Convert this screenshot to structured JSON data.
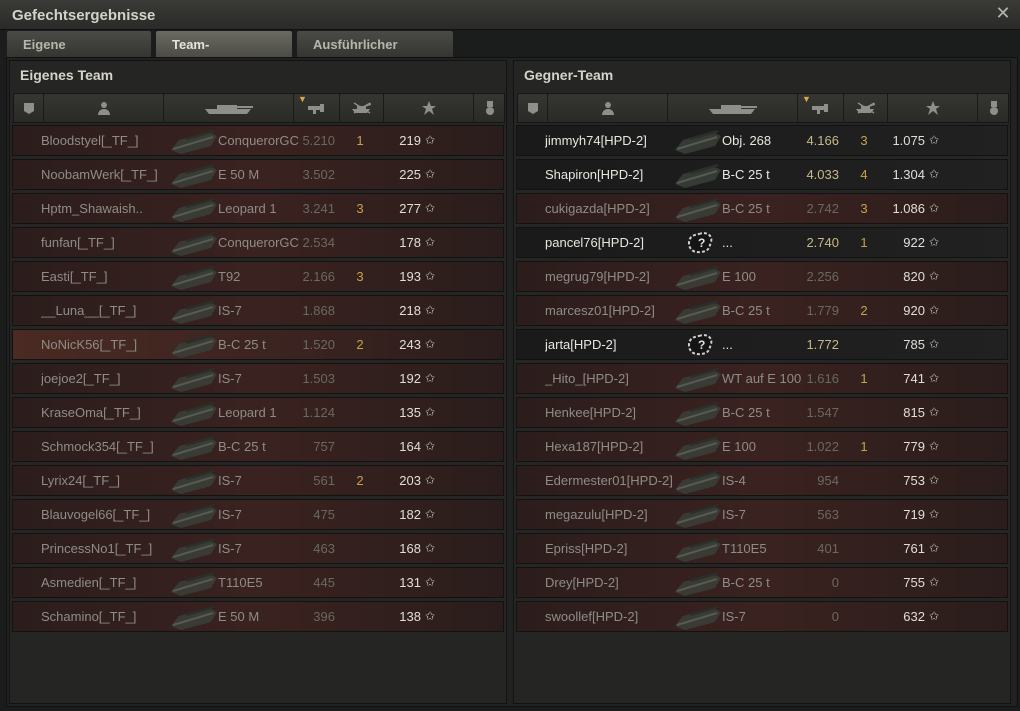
{
  "window": {
    "title": "Gefechtsergebnisse",
    "close_icon": "close-icon"
  },
  "tabs": [
    {
      "label": "Eigene Auswertung"
    },
    {
      "label": "Team-Auswertung"
    },
    {
      "label": "Ausführlicher Bericht"
    }
  ],
  "left_team": {
    "title": "Eigenes Team",
    "header_icons": [
      "squad-icon",
      "player-icon",
      "tank-icon",
      "damage-icon",
      "kills-icon",
      "experience-star-icon",
      "medal-icon"
    ],
    "rows": [
      {
        "player": "Bloodstyel[_TF_]",
        "tank": "ConquerorGC",
        "damage": "5.210",
        "kills": "1",
        "xp": "219"
      },
      {
        "player": "NoobamWerk[_TF_]",
        "tank": "E 50 M",
        "damage": "3.502",
        "kills": "",
        "xp": "225"
      },
      {
        "player": "Hptm_Shawaish..",
        "tank": "Leopard 1",
        "damage": "3.241",
        "kills": "3",
        "xp": "277"
      },
      {
        "player": "funfan[_TF_]",
        "tank": "ConquerorGC",
        "damage": "2.534",
        "kills": "",
        "xp": "178"
      },
      {
        "player": "Easti[_TF_]",
        "tank": "T92",
        "damage": "2.166",
        "kills": "3",
        "xp": "193"
      },
      {
        "player": "__Luna__[_TF_]",
        "tank": "IS-7",
        "damage": "1.868",
        "kills": "",
        "xp": "218"
      },
      {
        "player": "NoNicK56[_TF_]",
        "tank": "B-C 25 t",
        "damage": "1.520",
        "kills": "2",
        "xp": "243"
      },
      {
        "player": "joejoe2[_TF_]",
        "tank": "IS-7",
        "damage": "1.503",
        "kills": "",
        "xp": "192"
      },
      {
        "player": "KraseOma[_TF_]",
        "tank": "Leopard 1",
        "damage": "1.124",
        "kills": "",
        "xp": "135"
      },
      {
        "player": "Schmock354[_TF_]",
        "tank": "B-C 25 t",
        "damage": "757",
        "kills": "",
        "xp": "164"
      },
      {
        "player": "Lyrix24[_TF_]",
        "tank": "IS-7",
        "damage": "561",
        "kills": "2",
        "xp": "203"
      },
      {
        "player": "Blauvogel66[_TF_]",
        "tank": "IS-7",
        "damage": "475",
        "kills": "",
        "xp": "182"
      },
      {
        "player": "PrincessNo1[_TF_]",
        "tank": "IS-7",
        "damage": "463",
        "kills": "",
        "xp": "168"
      },
      {
        "player": "Asmedien[_TF_]",
        "tank": "T110E5",
        "damage": "445",
        "kills": "",
        "xp": "131"
      },
      {
        "player": "Schamino[_TF_]",
        "tank": "E 50 M",
        "damage": "396",
        "kills": "",
        "xp": "138"
      }
    ]
  },
  "right_team": {
    "title": "Gegner-Team",
    "rows": [
      {
        "player": "jimmyh74[HPD-2]",
        "tank": "Obj. 268",
        "damage": "4.166",
        "kills": "3",
        "xp": "1.075"
      },
      {
        "player": "Shapiron[HPD-2]",
        "tank": "B-C 25 t",
        "damage": "4.033",
        "kills": "4",
        "xp": "1.304"
      },
      {
        "player": "cukigazda[HPD-2]",
        "tank": "B-C 25 t",
        "damage": "2.742",
        "kills": "3",
        "xp": "1.086"
      },
      {
        "player": "pancel76[HPD-2]",
        "tank": "...",
        "damage": "2.740",
        "kills": "1",
        "xp": "922"
      },
      {
        "player": "megrug79[HPD-2]",
        "tank": "E 100",
        "damage": "2.256",
        "kills": "",
        "xp": "820"
      },
      {
        "player": "marcesz01[HPD-2]",
        "tank": "B-C 25 t",
        "damage": "1.779",
        "kills": "2",
        "xp": "920"
      },
      {
        "player": "jarta[HPD-2]",
        "tank": "...",
        "damage": "1.772",
        "kills": "",
        "xp": "785"
      },
      {
        "player": "_Hito_[HPD-2]",
        "tank": "WT auf E 100",
        "damage": "1.616",
        "kills": "1",
        "xp": "741"
      },
      {
        "player": "Henkee[HPD-2]",
        "tank": "B-C 25 t",
        "damage": "1.547",
        "kills": "",
        "xp": "815"
      },
      {
        "player": "Hexa187[HPD-2]",
        "tank": "E 100",
        "damage": "1.022",
        "kills": "1",
        "xp": "779"
      },
      {
        "player": "Edermester01[HPD-2]",
        "tank": "IS-4",
        "damage": "954",
        "kills": "",
        "xp": "753"
      },
      {
        "player": "megazulu[HPD-2]",
        "tank": "IS-7",
        "damage": "563",
        "kills": "",
        "xp": "719"
      },
      {
        "player": "Epriss[HPD-2]",
        "tank": "T110E5",
        "damage": "401",
        "kills": "",
        "xp": "761"
      },
      {
        "player": "Drey[HPD-2]",
        "tank": "B-C 25 t",
        "damage": "0",
        "kills": "",
        "xp": "755"
      },
      {
        "player": "swoollef[HPD-2]",
        "tank": "IS-7",
        "damage": "0",
        "kills": "",
        "xp": "632"
      }
    ]
  },
  "colors": {
    "accent": "#d6a94a",
    "row_dark": "#2b1d1c",
    "row_highlight": "#4a2a22"
  },
  "star_glyph": "✩"
}
